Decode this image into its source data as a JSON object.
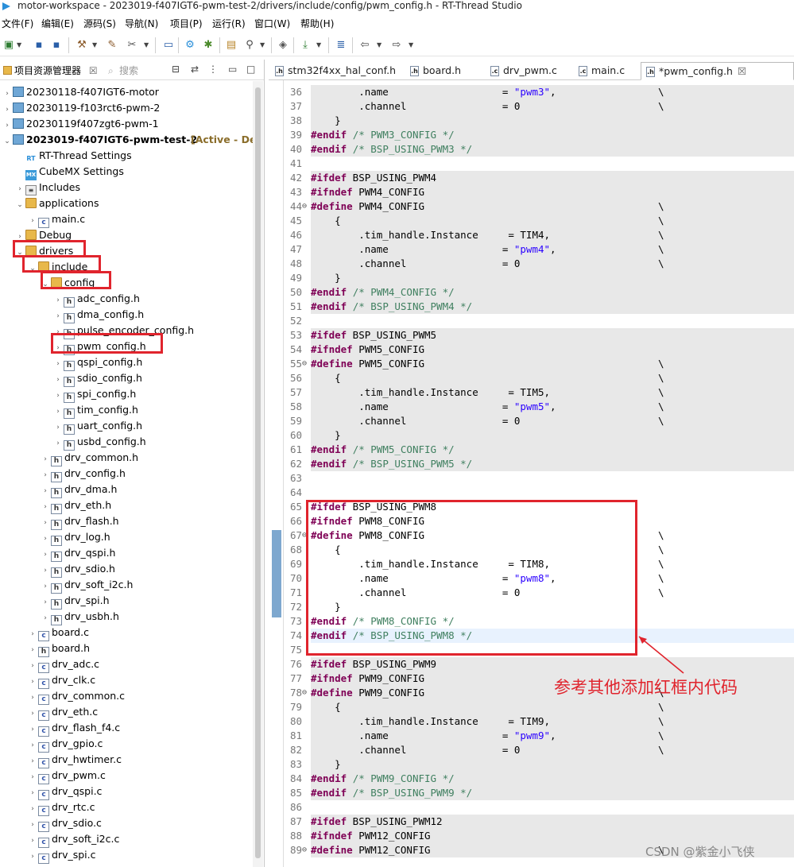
{
  "window": {
    "title": "motor-workspace - 2023019-f407IGT6-pwm-test-2/drivers/include/config/pwm_config.h - RT-Thread Studio"
  },
  "menu": [
    "文件(F)",
    "编辑(E)",
    "源码(S)",
    "导航(N)",
    "项目(P)",
    "运行(R)",
    "窗口(W)",
    "帮助(H)"
  ],
  "left_panel": {
    "tab_project": "项目资源管理器",
    "tab_search": "搜索",
    "tree": [
      {
        "label": "20230118-f407IGT6-motor",
        "icon": "project-icon"
      },
      {
        "label": "20230119-f103rct6-pwm-2",
        "icon": "project-icon"
      },
      {
        "label": "20230119f407zgt6-pwm-1",
        "icon": "project-icon"
      },
      {
        "label": "2023019-f407IGT6-pwm-test-2",
        "icon": "project-icon",
        "status": "[Active - Del"
      },
      {
        "label": "RT-Thread Settings",
        "icon": "rt-icon"
      },
      {
        "label": "CubeMX Settings",
        "icon": "mx-icon"
      },
      {
        "label": "Includes",
        "icon": "includes-icon"
      },
      {
        "label": "applications",
        "icon": "folder-icon"
      },
      {
        "label": "main.c",
        "icon": "c-file-icon"
      },
      {
        "label": "Debug",
        "icon": "folder-icon"
      },
      {
        "label": "drivers",
        "icon": "folder-icon"
      },
      {
        "label": "include",
        "icon": "folder-icon"
      },
      {
        "label": "config",
        "icon": "folder-icon"
      },
      {
        "label": "adc_config.h",
        "icon": "h-file-icon"
      },
      {
        "label": "dma_config.h",
        "icon": "h-file-icon"
      },
      {
        "label": "pulse_encoder_config.h",
        "icon": "h-file-icon"
      },
      {
        "label": "pwm_config.h",
        "icon": "h-file-icon"
      },
      {
        "label": "qspi_config.h",
        "icon": "h-file-icon"
      },
      {
        "label": "sdio_config.h",
        "icon": "h-file-icon"
      },
      {
        "label": "spi_config.h",
        "icon": "h-file-icon"
      },
      {
        "label": "tim_config.h",
        "icon": "h-file-icon"
      },
      {
        "label": "uart_config.h",
        "icon": "h-file-icon"
      },
      {
        "label": "usbd_config.h",
        "icon": "h-file-icon"
      },
      {
        "label": "drv_common.h",
        "icon": "h-file-icon"
      },
      {
        "label": "drv_config.h",
        "icon": "h-file-icon"
      },
      {
        "label": "drv_dma.h",
        "icon": "h-file-icon"
      },
      {
        "label": "drv_eth.h",
        "icon": "h-file-icon"
      },
      {
        "label": "drv_flash.h",
        "icon": "h-file-icon"
      },
      {
        "label": "drv_log.h",
        "icon": "h-file-icon"
      },
      {
        "label": "drv_qspi.h",
        "icon": "h-file-icon"
      },
      {
        "label": "drv_sdio.h",
        "icon": "h-file-icon"
      },
      {
        "label": "drv_soft_i2c.h",
        "icon": "h-file-icon"
      },
      {
        "label": "drv_spi.h",
        "icon": "h-file-icon"
      },
      {
        "label": "drv_usbh.h",
        "icon": "h-file-icon"
      },
      {
        "label": "board.c",
        "icon": "c-file-icon"
      },
      {
        "label": "board.h",
        "icon": "h-file-icon"
      },
      {
        "label": "drv_adc.c",
        "icon": "c-file-icon"
      },
      {
        "label": "drv_clk.c",
        "icon": "c-file-icon"
      },
      {
        "label": "drv_common.c",
        "icon": "c-file-icon"
      },
      {
        "label": "drv_eth.c",
        "icon": "c-file-icon"
      },
      {
        "label": "drv_flash_f4.c",
        "icon": "c-file-icon"
      },
      {
        "label": "drv_gpio.c",
        "icon": "c-file-icon"
      },
      {
        "label": "drv_hwtimer.c",
        "icon": "c-file-icon"
      },
      {
        "label": "drv_pwm.c",
        "icon": "c-file-icon"
      },
      {
        "label": "drv_qspi.c",
        "icon": "c-file-icon"
      },
      {
        "label": "drv_rtc.c",
        "icon": "c-file-icon"
      },
      {
        "label": "drv_sdio.c",
        "icon": "c-file-icon"
      },
      {
        "label": "drv_soft_i2c.c",
        "icon": "c-file-icon"
      },
      {
        "label": "drv_spi.c",
        "icon": "c-file-icon"
      }
    ]
  },
  "editor": {
    "tabs": [
      {
        "label": "stm32f4xx_hal_conf.h"
      },
      {
        "label": "board.h"
      },
      {
        "label": "drv_pwm.c"
      },
      {
        "label": "main.c"
      },
      {
        "label": "*pwm_config.h",
        "close": "☒"
      }
    ],
    "lines": [
      {
        "n": "36",
        "code": "        .name                   = \"pwm3\",",
        "bs": "\\",
        "bg": "gray"
      },
      {
        "n": "37",
        "code": "        .channel                = 0",
        "bs": "\\",
        "bg": "gray"
      },
      {
        "n": "38",
        "code": "    }",
        "bs": "",
        "bg": "gray"
      },
      {
        "n": "39",
        "code": "#endif /* PWM3_CONFIG */",
        "bs": "",
        "bg": "gray"
      },
      {
        "n": "40",
        "code": "#endif /* BSP_USING_PWM3 */",
        "bs": "",
        "bg": "gray"
      },
      {
        "n": "41",
        "code": "",
        "bs": "",
        "bg": ""
      },
      {
        "n": "42",
        "code": "#ifdef BSP_USING_PWM4",
        "bs": "",
        "bg": "gray"
      },
      {
        "n": "43",
        "code": "#ifndef PWM4_CONFIG",
        "bs": "",
        "bg": "gray"
      },
      {
        "n": "44",
        "code": "#define PWM4_CONFIG",
        "bs": "\\",
        "bg": "gray",
        "fold": "⊖"
      },
      {
        "n": "45",
        "code": "    {",
        "bs": "\\",
        "bg": "gray"
      },
      {
        "n": "46",
        "code": "        .tim_handle.Instance     = TIM4,",
        "bs": "\\",
        "bg": "gray"
      },
      {
        "n": "47",
        "code": "        .name                   = \"pwm4\",",
        "bs": "\\",
        "bg": "gray"
      },
      {
        "n": "48",
        "code": "        .channel                = 0",
        "bs": "\\",
        "bg": "gray"
      },
      {
        "n": "49",
        "code": "    }",
        "bs": "",
        "bg": "gray"
      },
      {
        "n": "50",
        "code": "#endif /* PWM4_CONFIG */",
        "bs": "",
        "bg": "gray"
      },
      {
        "n": "51",
        "code": "#endif /* BSP_USING_PWM4 */",
        "bs": "",
        "bg": "gray"
      },
      {
        "n": "52",
        "code": "",
        "bs": "",
        "bg": ""
      },
      {
        "n": "53",
        "code": "#ifdef BSP_USING_PWM5",
        "bs": "",
        "bg": "gray"
      },
      {
        "n": "54",
        "code": "#ifndef PWM5_CONFIG",
        "bs": "",
        "bg": "gray"
      },
      {
        "n": "55",
        "code": "#define PWM5_CONFIG",
        "bs": "\\",
        "bg": "gray",
        "fold": "⊖"
      },
      {
        "n": "56",
        "code": "    {",
        "bs": "\\",
        "bg": "gray"
      },
      {
        "n": "57",
        "code": "        .tim_handle.Instance     = TIM5,",
        "bs": "\\",
        "bg": "gray"
      },
      {
        "n": "58",
        "code": "        .name                   = \"pwm5\",",
        "bs": "\\",
        "bg": "gray"
      },
      {
        "n": "59",
        "code": "        .channel                = 0",
        "bs": "\\",
        "bg": "gray"
      },
      {
        "n": "60",
        "code": "    }",
        "bs": "",
        "bg": "gray"
      },
      {
        "n": "61",
        "code": "#endif /* PWM5_CONFIG */",
        "bs": "",
        "bg": "gray"
      },
      {
        "n": "62",
        "code": "#endif /* BSP_USING_PWM5 */",
        "bs": "",
        "bg": "gray"
      },
      {
        "n": "63",
        "code": "",
        "bs": "",
        "bg": ""
      },
      {
        "n": "64",
        "code": "",
        "bs": "",
        "bg": ""
      },
      {
        "n": "65",
        "code": "#ifdef BSP_USING_PWM8",
        "bs": "",
        "bg": ""
      },
      {
        "n": "66",
        "code": "#ifndef PWM8_CONFIG",
        "bs": "",
        "bg": ""
      },
      {
        "n": "67",
        "code": "#define PWM8_CONFIG",
        "bs": "\\",
        "bg": "",
        "fold": "⊖"
      },
      {
        "n": "68",
        "code": "    {",
        "bs": "\\",
        "bg": ""
      },
      {
        "n": "69",
        "code": "        .tim_handle.Instance     = TIM8,",
        "bs": "\\",
        "bg": ""
      },
      {
        "n": "70",
        "code": "        .name                   = \"pwm8\",",
        "bs": "\\",
        "bg": ""
      },
      {
        "n": "71",
        "code": "        .channel                = 0",
        "bs": "\\",
        "bg": ""
      },
      {
        "n": "72",
        "code": "    }",
        "bs": "",
        "bg": ""
      },
      {
        "n": "73",
        "code": "#endif /* PWM8_CONFIG */",
        "bs": "",
        "bg": ""
      },
      {
        "n": "74",
        "code": "#endif /* BSP_USING_PWM8 */",
        "bs": "",
        "bg": "cur"
      },
      {
        "n": "75",
        "code": "",
        "bs": "",
        "bg": ""
      },
      {
        "n": "76",
        "code": "#ifdef BSP_USING_PWM9",
        "bs": "",
        "bg": "gray"
      },
      {
        "n": "77",
        "code": "#ifndef PWM9_CONFIG",
        "bs": "",
        "bg": "gray"
      },
      {
        "n": "78",
        "code": "#define PWM9_CONFIG",
        "bs": "\\",
        "bg": "gray",
        "fold": "⊖"
      },
      {
        "n": "79",
        "code": "    {",
        "bs": "\\",
        "bg": "gray"
      },
      {
        "n": "80",
        "code": "        .tim_handle.Instance     = TIM9,",
        "bs": "\\",
        "bg": "gray"
      },
      {
        "n": "81",
        "code": "        .name                   = \"pwm9\",",
        "bs": "\\",
        "bg": "gray"
      },
      {
        "n": "82",
        "code": "        .channel                = 0",
        "bs": "\\",
        "bg": "gray"
      },
      {
        "n": "83",
        "code": "    }",
        "bs": "",
        "bg": "gray"
      },
      {
        "n": "84",
        "code": "#endif /* PWM9_CONFIG */",
        "bs": "",
        "bg": "gray"
      },
      {
        "n": "85",
        "code": "#endif /* BSP_USING_PWM9 */",
        "bs": "",
        "bg": "gray"
      },
      {
        "n": "86",
        "code": "",
        "bs": "",
        "bg": ""
      },
      {
        "n": "87",
        "code": "#ifdef BSP_USING_PWM12",
        "bs": "",
        "bg": "gray"
      },
      {
        "n": "88",
        "code": "#ifndef PWM12_CONFIG",
        "bs": "",
        "bg": "gray"
      },
      {
        "n": "89",
        "code": "#define PWM12_CONFIG",
        "bs": "\\",
        "bg": "gray",
        "fold": "⊖"
      }
    ]
  },
  "annotation": "参考其他添加红框内代码",
  "watermark": "CSDN @紫金小飞侠",
  "colors": {
    "highlight_red": "#e0242d",
    "keyword": "#7f0055",
    "comment": "#3f7f5f",
    "string": "#2a00ff"
  }
}
